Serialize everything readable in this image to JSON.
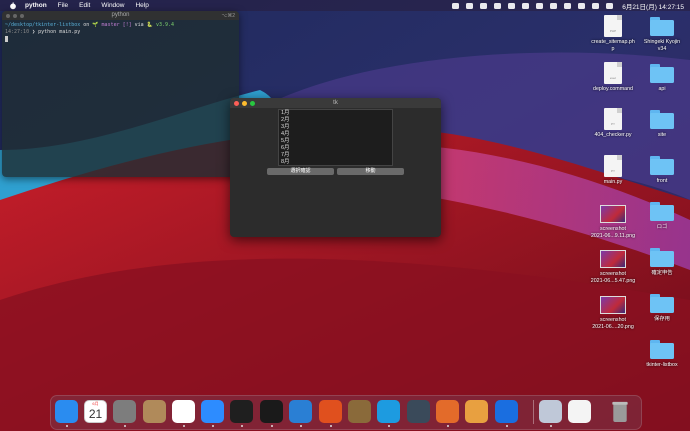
{
  "menubar": {
    "app": "python",
    "items": [
      "File",
      "Edit",
      "Window",
      "Help"
    ],
    "clock": "6月21日(月)  14:27:15"
  },
  "terminal": {
    "title": "python",
    "badge": "⌥⌘2",
    "line1_path": "~/desktop/tkinter-listbox",
    "line1_on": " on ",
    "line1_branch": "🌱 master [!]",
    "line1_via": " via ",
    "line1_py": "🐍 v3.9.4",
    "line2_time": "14:27:10",
    "line2_cmd": " ❯ python main.py"
  },
  "tk": {
    "title": "tk",
    "months": [
      "1月",
      "2月",
      "3月",
      "4月",
      "5月",
      "6月",
      "7月",
      "8月"
    ],
    "confirm_button": "選択確認",
    "move_button": "移動"
  },
  "desktop": {
    "files": [
      {
        "label": "create_sitemap.ph\np",
        "kind": "doc",
        "tag": "PHP"
      },
      {
        "label": "deploy.command",
        "kind": "doc",
        "tag": "exec"
      },
      {
        "label": "404_checker.py",
        "kind": "doc",
        "tag": "PY"
      },
      {
        "label": "main.py",
        "kind": "doc",
        "tag": "PY"
      },
      {
        "label": "screenshot\n2021-06...9.11.png",
        "kind": "thumb"
      },
      {
        "label": "screenshot\n2021-06...5.47.png",
        "kind": "thumb"
      },
      {
        "label": "screenshot\n2021-06....20.png",
        "kind": "thumb"
      }
    ],
    "folders": [
      "Shingeki Kyojin\nv34",
      "api",
      "site",
      "front",
      "ロゴ",
      "確定申告",
      "保存用",
      "tkinter-listbox"
    ]
  },
  "dock": {
    "apps": [
      "Finder",
      "Calendar",
      "System Preferences",
      "Contacts",
      "Chrome",
      "Zoom",
      "Activity Monitor",
      "Terminal",
      "VS Code",
      "Instruments",
      "Archive Utility",
      "Docker",
      "Proxyman",
      "Git",
      "Sequel",
      "Infinity",
      "Preview",
      "Document",
      "Trash"
    ],
    "calendar_month": "6月",
    "calendar_day": "21",
    "colors": [
      "#2a8cf0",
      "#ffffff",
      "#7d7d7d",
      "#b08a5a",
      "#ffffff",
      "#2d8cff",
      "#1f1f1f",
      "#1a1a1a",
      "#2a7fd4",
      "#e0501e",
      "#8a6a3a",
      "#1d9be0",
      "#3a4a5a",
      "#e36b2a",
      "#e8a040",
      "#1a6ee0",
      "#bfc8d8",
      "#f4f4f4",
      "#777777"
    ]
  }
}
